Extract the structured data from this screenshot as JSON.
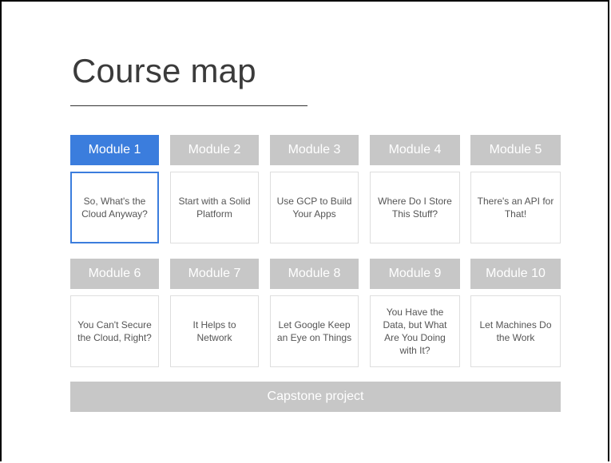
{
  "title": "Course map",
  "modules": [
    {
      "label": "Module 1",
      "description": "So, What's the Cloud Anyway?",
      "active": true
    },
    {
      "label": "Module 2",
      "description": "Start with a Solid Platform",
      "active": false
    },
    {
      "label": "Module 3",
      "description": "Use GCP to Build Your Apps",
      "active": false
    },
    {
      "label": "Module 4",
      "description": "Where Do I Store This Stuff?",
      "active": false
    },
    {
      "label": "Module 5",
      "description": "There's an API for That!",
      "active": false
    },
    {
      "label": "Module 6",
      "description": "You Can't Secure the Cloud, Right?",
      "active": false
    },
    {
      "label": "Module 7",
      "description": "It Helps to Network",
      "active": false
    },
    {
      "label": "Module 8",
      "description": "Let Google Keep an Eye on Things",
      "active": false
    },
    {
      "label": "Module 9",
      "description": "You Have the Data, but What Are You Doing with It?",
      "active": false
    },
    {
      "label": "Module 10",
      "description": "Let Machines Do the Work",
      "active": false
    }
  ],
  "capstone": "Capstone project",
  "colors": {
    "active": "#3b7ddd",
    "inactive": "#c7c7c7"
  }
}
